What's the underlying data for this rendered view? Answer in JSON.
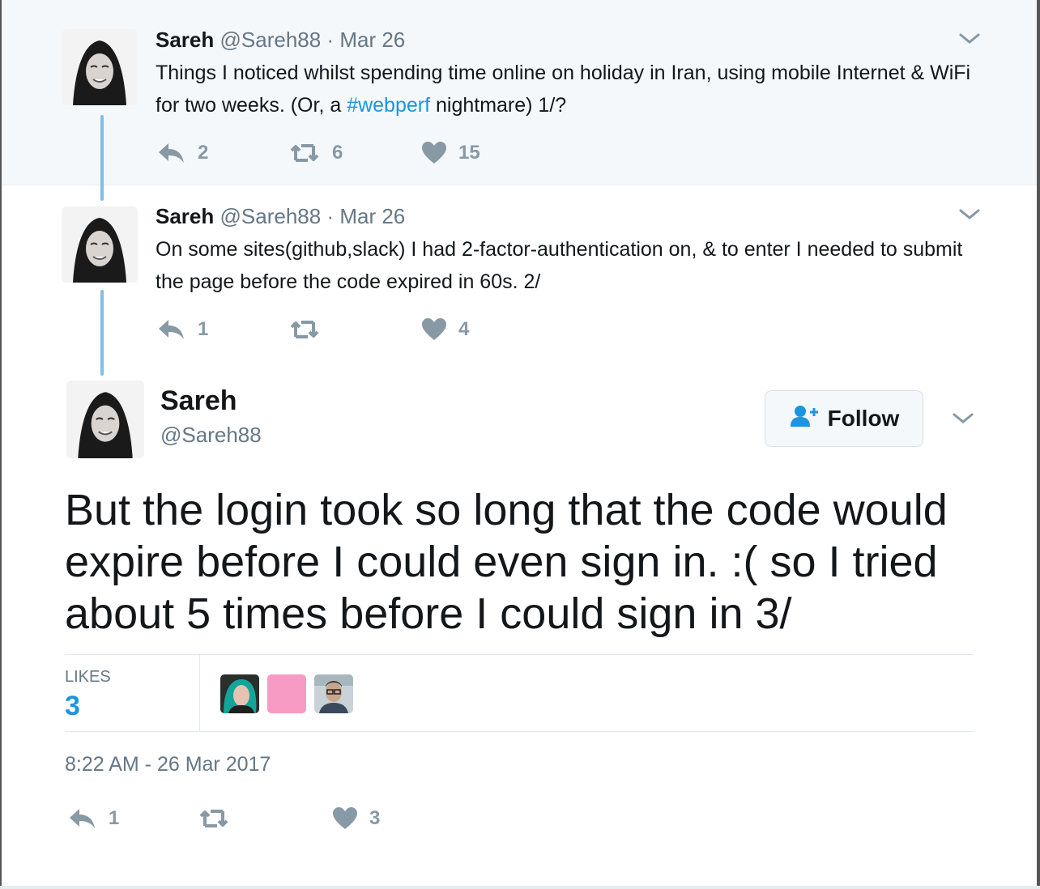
{
  "thread": [
    {
      "name": "Sareh",
      "handle": "@Sareh88",
      "separator": "·",
      "date": "Mar 26",
      "text_before": "Things I noticed whilst spending time online on holiday in Iran, using mobile Internet & WiFi for two weeks. (Or, a ",
      "hashtag": "#webperf",
      "text_after": " nightmare) 1/?",
      "replies": "2",
      "retweets": "6",
      "likes": "15"
    },
    {
      "name": "Sareh",
      "handle": "@Sareh88",
      "separator": "·",
      "date": "Mar 26",
      "text": "On some sites(github,slack) I had 2-factor-authentication on, & to enter I needed to submit the page before the code expired in 60s. 2/",
      "replies": "1",
      "retweets": "",
      "likes": "4"
    }
  ],
  "main": {
    "name": "Sareh",
    "handle": "@Sareh88",
    "follow_label": "Follow",
    "text": "But the login took so long that the code would expire before I could even sign in. :( so I tried about 5 times before I could sign in 3/",
    "likes_label": "LIKES",
    "likes_count": "3",
    "timestamp": "8:22 AM - 26 Mar 2017",
    "replies": "1",
    "retweets": "",
    "likes": "3"
  },
  "colors": {
    "accent": "#1b95e0",
    "thread_line": "#7fbfe6",
    "muted": "#657786",
    "icon": "#8899a6",
    "ancestor_bg": "#f5f8fa"
  },
  "icons": [
    "reply-icon",
    "retweet-icon",
    "heart-icon",
    "chevron-down-icon",
    "follow-person-icon"
  ]
}
